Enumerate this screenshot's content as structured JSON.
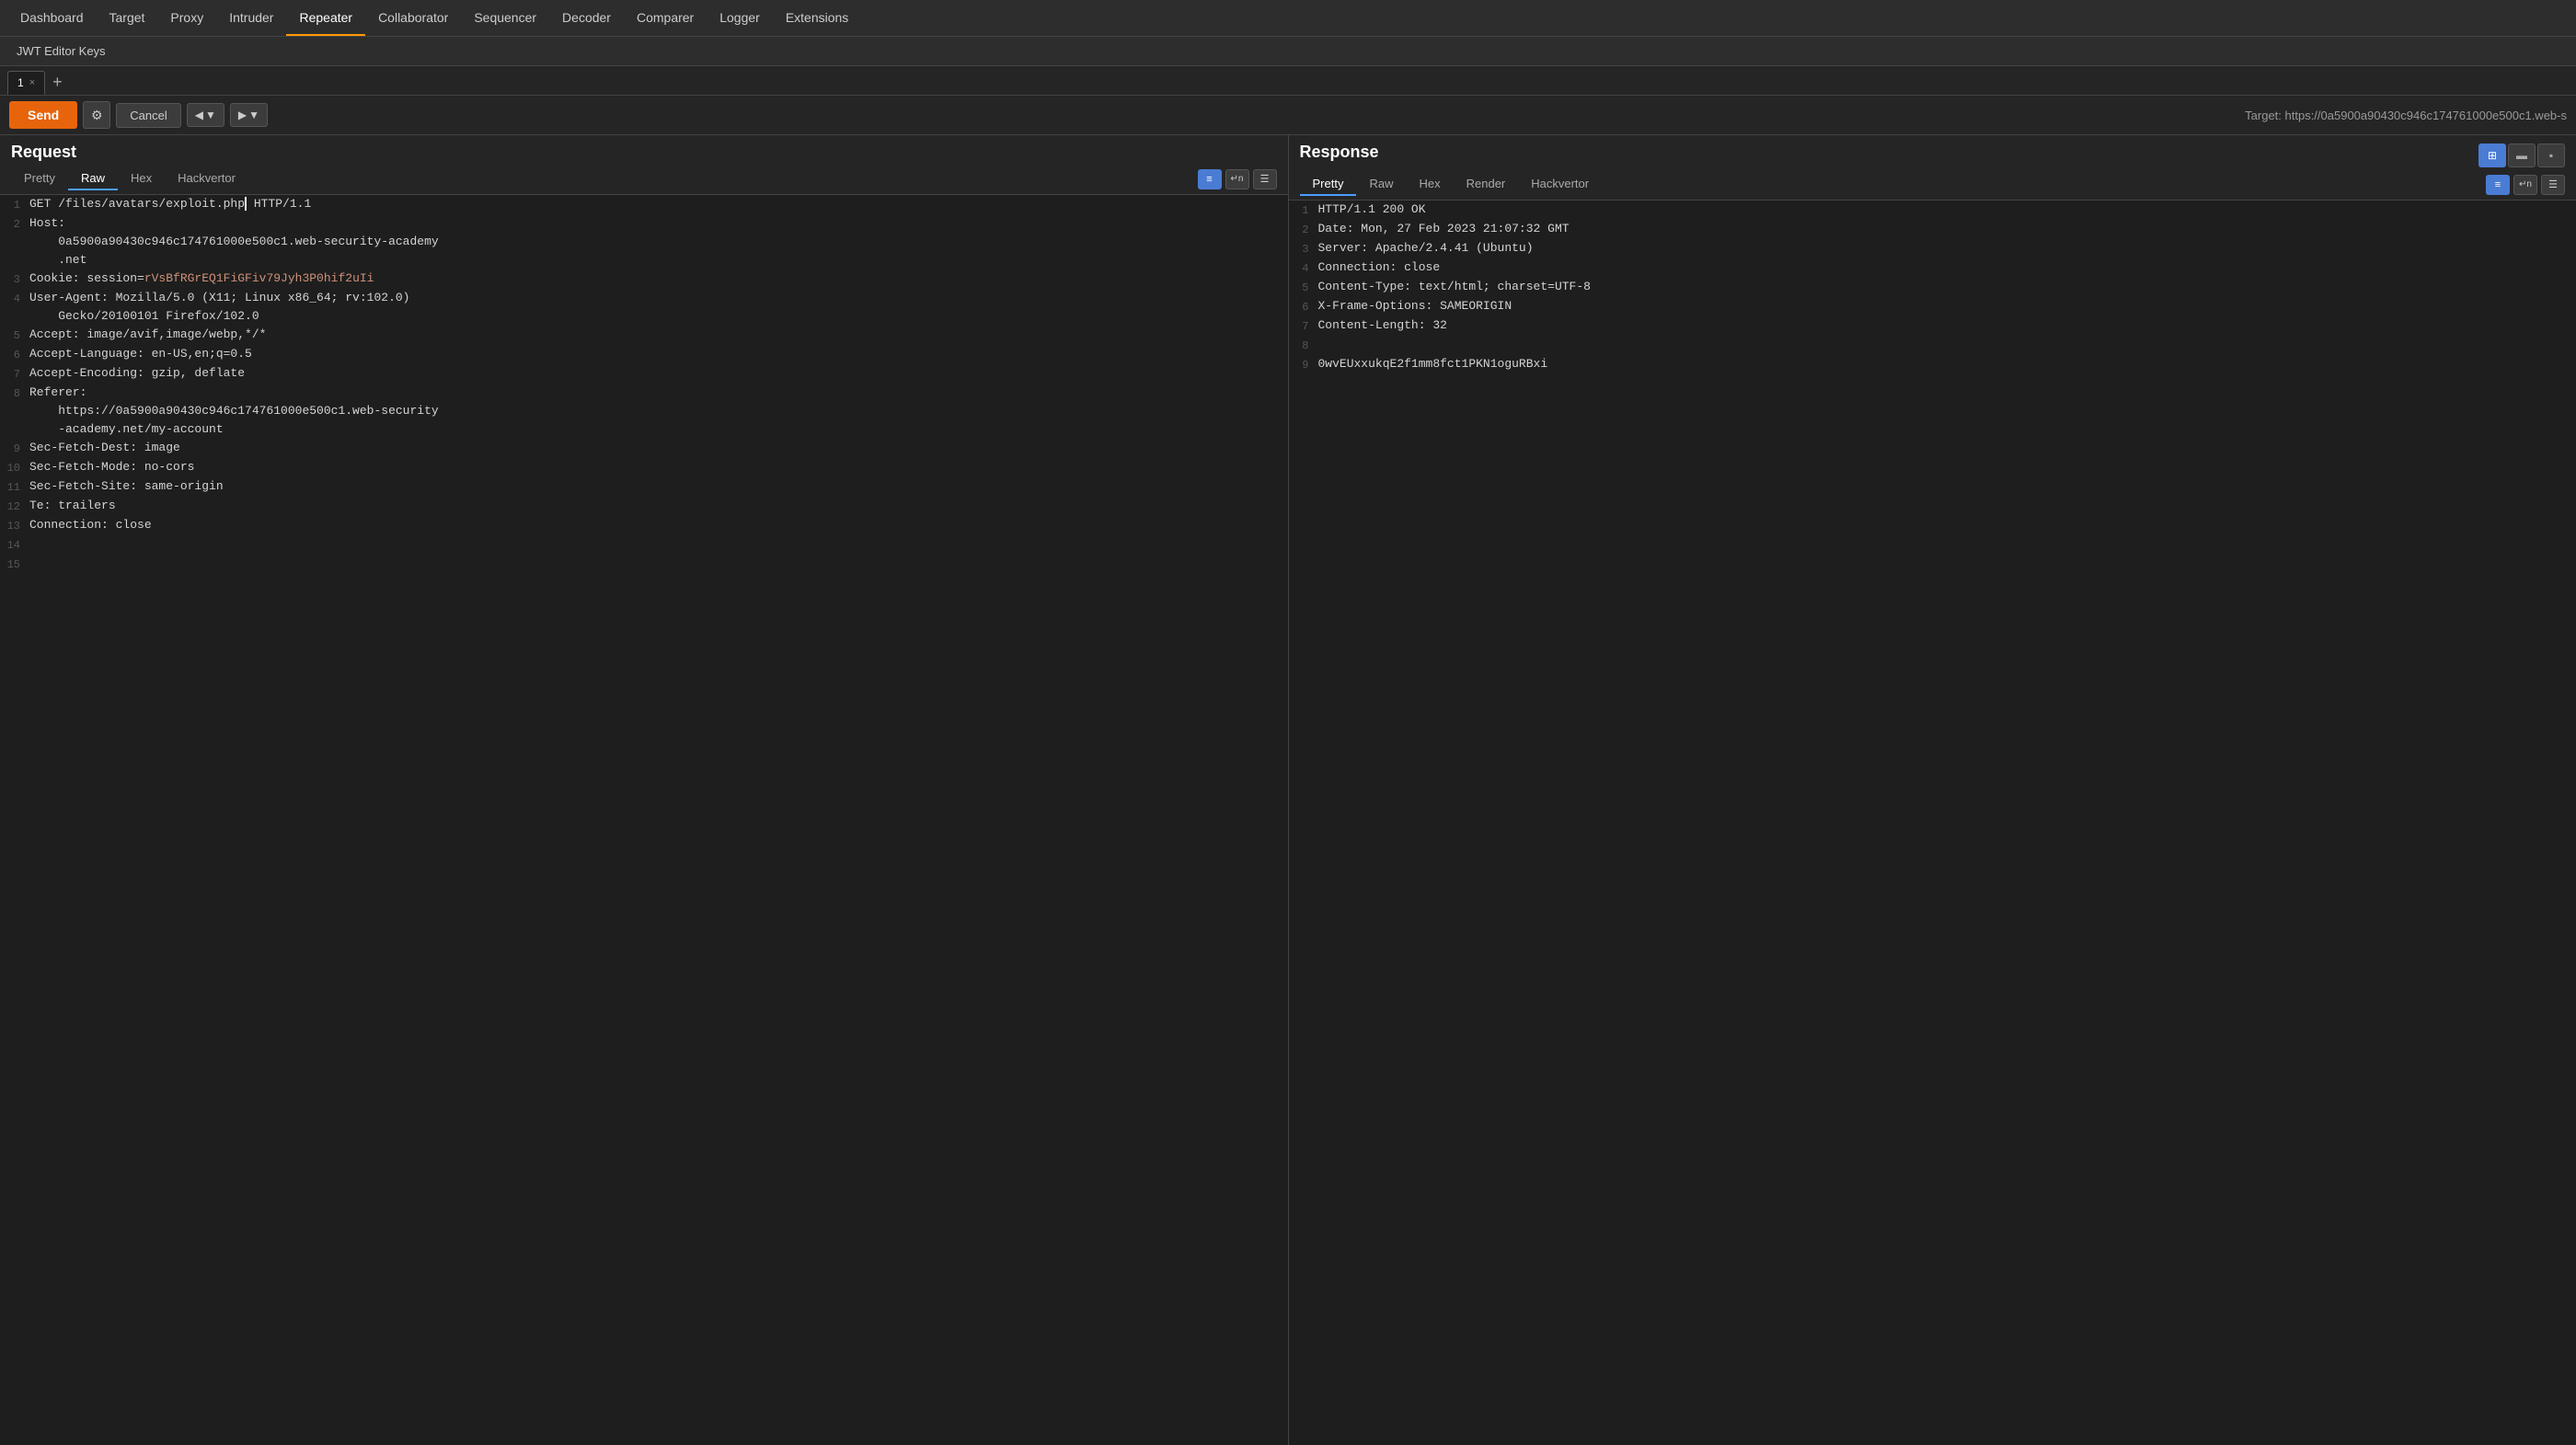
{
  "nav": {
    "items": [
      {
        "label": "Dashboard",
        "active": false
      },
      {
        "label": "Target",
        "active": false
      },
      {
        "label": "Proxy",
        "active": false
      },
      {
        "label": "Intruder",
        "active": false
      },
      {
        "label": "Repeater",
        "active": true
      },
      {
        "label": "Collaborator",
        "active": false
      },
      {
        "label": "Sequencer",
        "active": false
      },
      {
        "label": "Decoder",
        "active": false
      },
      {
        "label": "Comparer",
        "active": false
      },
      {
        "label": "Logger",
        "active": false
      },
      {
        "label": "Extensions",
        "active": false
      }
    ]
  },
  "sub_nav": {
    "item": "JWT Editor Keys"
  },
  "tabs": {
    "active_tab": "1",
    "add_label": "+"
  },
  "toolbar": {
    "send_label": "Send",
    "cancel_label": "Cancel",
    "target_label": "Target: https://0a5900a90430c946c174761000e500c1.web-s"
  },
  "request": {
    "title": "Request",
    "tabs": [
      "Pretty",
      "Raw",
      "Hex",
      "Hackvertor"
    ],
    "active_tab": "Raw",
    "lines": [
      {
        "num": 1,
        "content": "GET /files/avatars/exploit.php HTTP/1.1"
      },
      {
        "num": 2,
        "content": "Host:"
      },
      {
        "num": 2,
        "content_indent": "0a5900a90430c946c174761000e500c1.web-security-academy"
      },
      {
        "num": 2,
        "content_2": ".net"
      },
      {
        "num": 3,
        "content": "Cookie: session=rVsBfRGrEQ1FiGFiv79Jyh3P0hif2uIi"
      },
      {
        "num": 4,
        "content": "User-Agent: Mozilla/5.0 (X11; Linux x86_64; rv:102.0)"
      },
      {
        "num": 4,
        "content_2": "Gecko/20100101 Firefox/102.0"
      },
      {
        "num": 5,
        "content": "Accept: image/avif,image/webp,*/*"
      },
      {
        "num": 6,
        "content": "Accept-Language: en-US,en;q=0.5"
      },
      {
        "num": 7,
        "content": "Accept-Encoding: gzip, deflate"
      },
      {
        "num": 8,
        "content": "Referer:"
      },
      {
        "num": 8,
        "content_2": "https://0a5900a90430c946c174761000e500c1.web-security"
      },
      {
        "num": 8,
        "content_3": "-academy.net/my-account"
      },
      {
        "num": 9,
        "content": "Sec-Fetch-Dest: image"
      },
      {
        "num": 10,
        "content": "Sec-Fetch-Mode: no-cors"
      },
      {
        "num": 11,
        "content": "Sec-Fetch-Site: same-origin"
      },
      {
        "num": 12,
        "content": "Te: trailers"
      },
      {
        "num": 13,
        "content": "Connection: close"
      },
      {
        "num": 14,
        "content": ""
      },
      {
        "num": 15,
        "content": ""
      }
    ]
  },
  "response": {
    "title": "Response",
    "tabs": [
      "Pretty",
      "Raw",
      "Hex",
      "Render",
      "Hackvertor"
    ],
    "active_tab": "Pretty",
    "lines": [
      {
        "num": 1,
        "content": "HTTP/1.1 200 OK"
      },
      {
        "num": 2,
        "content": "Date: Mon, 27 Feb 2023 21:07:32 GMT"
      },
      {
        "num": 3,
        "content": "Server: Apache/2.4.41 (Ubuntu)"
      },
      {
        "num": 4,
        "content": "Connection: close"
      },
      {
        "num": 5,
        "content": "Content-Type: text/html; charset=UTF-8"
      },
      {
        "num": 6,
        "content": "X-Frame-Options: SAMEORIGIN"
      },
      {
        "num": 7,
        "content": "Content-Length: 32"
      },
      {
        "num": 8,
        "content": ""
      },
      {
        "num": 9,
        "content": "0wvEUxxukqE2f1mm8fct1PKN1oguRBxi"
      }
    ]
  }
}
